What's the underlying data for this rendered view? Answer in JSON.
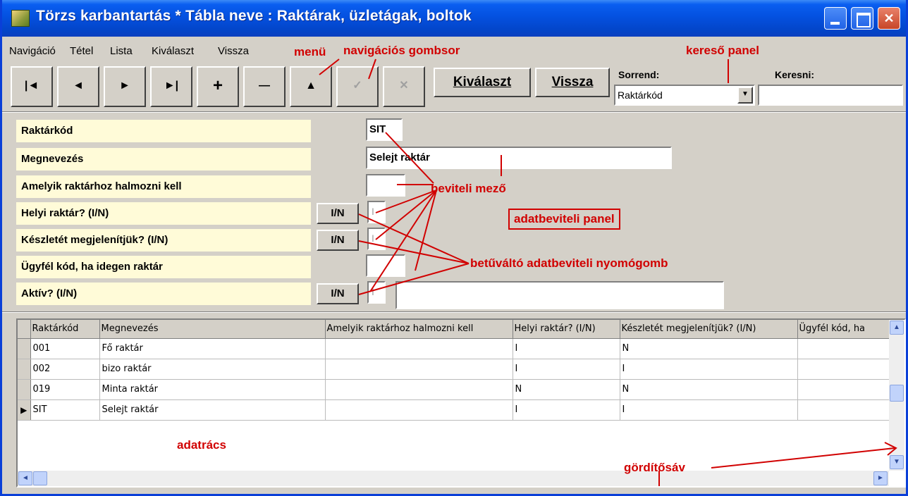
{
  "window": {
    "title": "Törzs karbantartás * Tábla neve : Raktárak, üzletágak, boltok",
    "buttons": [
      "_",
      "□",
      "✕"
    ]
  },
  "menu": {
    "items": [
      "Navigáció",
      "Tétel",
      "Lista",
      "Kiválaszt",
      "Vissza"
    ]
  },
  "toolbar": {
    "nav_buttons": [
      {
        "icon": "first-record-icon",
        "glyph": "|◄"
      },
      {
        "icon": "prev-record-icon",
        "glyph": "◄"
      },
      {
        "icon": "next-record-icon",
        "glyph": "►"
      },
      {
        "icon": "last-record-icon",
        "glyph": "►|"
      },
      {
        "icon": "insert-icon",
        "glyph": "+"
      },
      {
        "icon": "delete-icon",
        "glyph": "—"
      },
      {
        "icon": "edit-icon",
        "glyph": "▲"
      },
      {
        "icon": "post-icon",
        "glyph": "✓"
      },
      {
        "icon": "cancel-icon",
        "glyph": "✕"
      }
    ],
    "kivalaszt_label": "Kiválaszt",
    "vissza_label": "Vissza"
  },
  "search_panel": {
    "order_label": "Sorrend:",
    "order_value": "Raktárkód",
    "search_label": "Keresni:",
    "search_value": ""
  },
  "form": {
    "fields": [
      {
        "label": "Raktárkód",
        "value": "SIT"
      },
      {
        "label": "Megnevezés",
        "value": "Selejt raktár"
      },
      {
        "label": "Amelyik raktárhoz halmozni kell",
        "value": ""
      },
      {
        "label": "Helyi raktár? (I/N)",
        "value": "I",
        "button": "I/N"
      },
      {
        "label": "Készletét megjelenítjük? (I/N)",
        "value": "I",
        "button": "I/N"
      },
      {
        "label": "Ügyfél kód, ha idegen raktár",
        "value": ""
      },
      {
        "label": "Aktív? (I/N)",
        "value": "I",
        "button": "I/N"
      }
    ]
  },
  "grid": {
    "columns": [
      "Raktárkód",
      "Megnevezés",
      "Amelyik raktárhoz halmozni kell",
      "Helyi raktár? (I/N)",
      "Készletét megjelenítjük? (I/N)",
      "Ügyfél kód, ha"
    ],
    "rows": [
      [
        "001",
        "Fő raktár",
        "",
        "I",
        "N",
        ""
      ],
      [
        "002",
        "bizo raktár",
        "",
        "I",
        "I",
        ""
      ],
      [
        "019",
        "Minta raktár",
        "",
        "N",
        "N",
        ""
      ],
      [
        "SIT",
        "Selejt raktár",
        "",
        "I",
        "I",
        ""
      ]
    ],
    "current_row_indicator": "▶"
  },
  "annotations": {
    "menu": "menü",
    "nav_bar": "navigációs gombsor",
    "search_panel": "kereső panel",
    "input_field": "beviteli mező",
    "input_panel": "adatbeviteli panel",
    "toggle_button": "betűváltó adatbeviteli nyomógomb",
    "grid": "adatrács",
    "scrollbar": "gördítősáv"
  },
  "colors": {
    "annotation": "#d10000",
    "field_label_bg": "#fffbd8",
    "titlebar": "#0451e0"
  }
}
